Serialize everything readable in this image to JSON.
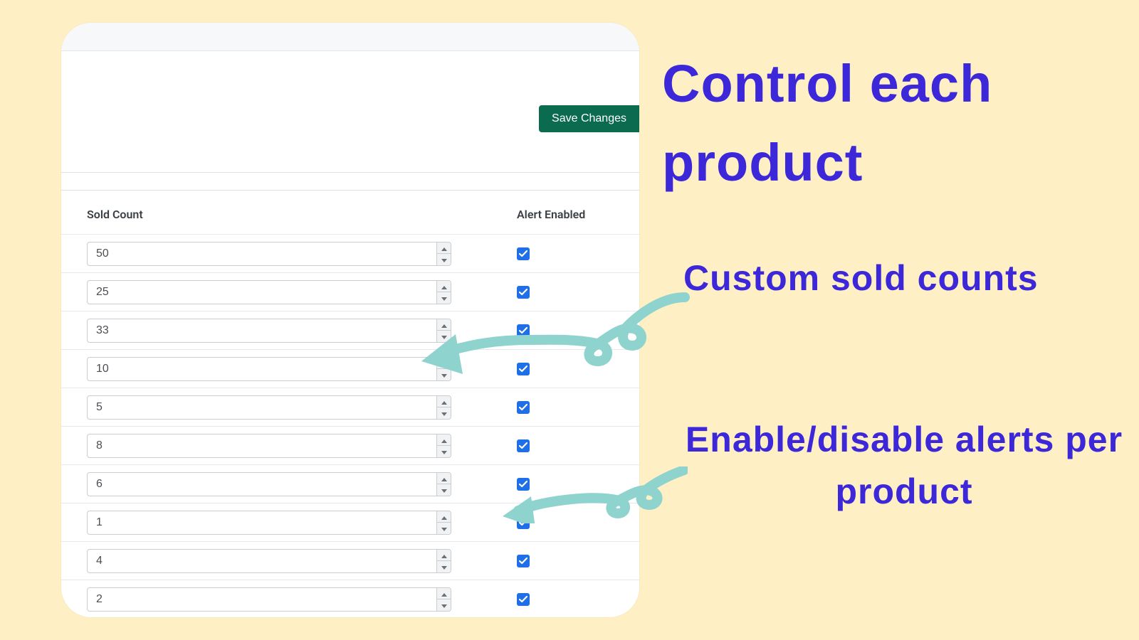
{
  "colors": {
    "accent_button": "#0b6b4f",
    "annotation_text": "#3d28d9",
    "arrow": "#8fd3ce",
    "checkbox": "#1f6fe8",
    "page_bg": "#feefc4"
  },
  "panel": {
    "save_label": "Save Changes",
    "headers": {
      "sold_count": "Sold Count",
      "alert_enabled": "Alert Enabled"
    },
    "rows": [
      {
        "sold": "50",
        "alert": true
      },
      {
        "sold": "25",
        "alert": true
      },
      {
        "sold": "33",
        "alert": true
      },
      {
        "sold": "10",
        "alert": true
      },
      {
        "sold": "5",
        "alert": true
      },
      {
        "sold": "8",
        "alert": true
      },
      {
        "sold": "6",
        "alert": true
      },
      {
        "sold": "1",
        "alert": true
      },
      {
        "sold": "4",
        "alert": true
      },
      {
        "sold": "2",
        "alert": true
      }
    ]
  },
  "annotations": {
    "heading": "Control each product",
    "sub1": "Custom sold counts",
    "sub2": "Enable/disable alerts per product"
  }
}
